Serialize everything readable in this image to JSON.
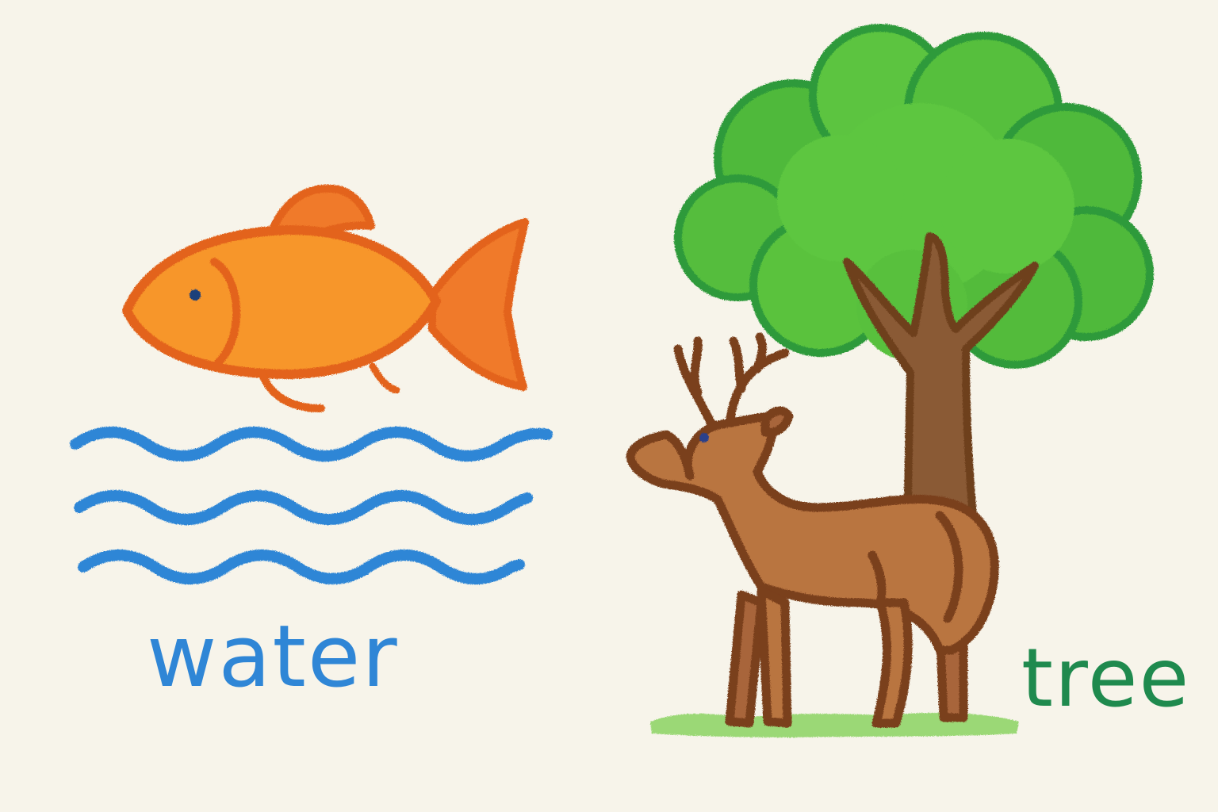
{
  "labels": {
    "water": "water",
    "tree": "tree"
  },
  "colors": {
    "paper": "#f7f4ea",
    "water_text": "#2f86d6",
    "tree_text": "#1f8a4e",
    "fish_fill": "#f7962b",
    "fish_outline": "#e3641a",
    "waves": "#2f86d6",
    "foliage": "#4fb93a",
    "foliage_outline": "#2f9a3a",
    "trunk": "#8a5a34",
    "deer_fill": "#b97440",
    "deer_outline": "#7a3f1e",
    "grass": "#7ccf4f"
  },
  "icons": [
    "fish-icon",
    "water-waves-icon",
    "tree-icon",
    "deer-icon",
    "grass-icon"
  ]
}
